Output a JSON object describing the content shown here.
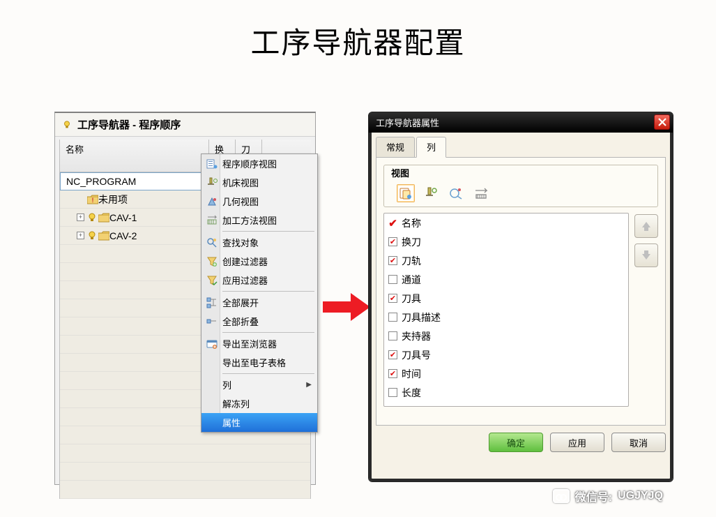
{
  "page_title": "工序导航器配置",
  "navigator": {
    "title": "工序导航器 - 程序顺序",
    "columns": [
      "名称",
      "换",
      "刀轨"
    ],
    "rows": [
      {
        "label": "NC_PROGRAM",
        "indent": 0,
        "selected": true,
        "expander": null
      },
      {
        "label": "未用项",
        "indent": 1,
        "selected": false,
        "expander": null,
        "icon": "folder-warn"
      },
      {
        "label": "CAV-1",
        "indent": 2,
        "selected": false,
        "expander": "+",
        "icon": "folder-bulb"
      },
      {
        "label": "CAV-2",
        "indent": 2,
        "selected": false,
        "expander": "+",
        "icon": "folder-bulb"
      }
    ]
  },
  "context_menu": {
    "groups": [
      [
        {
          "label": "程序顺序视图",
          "icon": "seq-view"
        },
        {
          "label": "机床视图",
          "icon": "machine-view"
        },
        {
          "label": "几何视图",
          "icon": "geom-view"
        },
        {
          "label": "加工方法视图",
          "icon": "method-view"
        }
      ],
      [
        {
          "label": "查找对象",
          "icon": "find"
        },
        {
          "label": "创建过滤器",
          "icon": "filter-new"
        },
        {
          "label": "应用过滤器",
          "icon": "filter-apply"
        }
      ],
      [
        {
          "label": "全部展开",
          "icon": "expand-all"
        },
        {
          "label": "全部折叠",
          "icon": "collapse-all"
        }
      ],
      [
        {
          "label": "导出至浏览器",
          "icon": "export-browser"
        },
        {
          "label": "导出至电子表格",
          "icon": "export-sheet"
        }
      ],
      [
        {
          "label": "列",
          "submenu": true
        },
        {
          "label": "解冻列"
        },
        {
          "label": "属性",
          "highlight": true
        }
      ]
    ]
  },
  "dialog": {
    "title": "工序导航器属性",
    "tabs": {
      "general": "常规",
      "columns": "列",
      "active": "columns"
    },
    "view_group": "视图",
    "column_options": [
      {
        "label": "名称",
        "state": "locked"
      },
      {
        "label": "换刀",
        "state": "checked"
      },
      {
        "label": "刀轨",
        "state": "checked"
      },
      {
        "label": "通道",
        "state": "unchecked"
      },
      {
        "label": "刀具",
        "state": "checked"
      },
      {
        "label": "刀具描述",
        "state": "unchecked"
      },
      {
        "label": "夹持器",
        "state": "unchecked"
      },
      {
        "label": "刀具号",
        "state": "checked"
      },
      {
        "label": "时间",
        "state": "checked"
      },
      {
        "label": "长度",
        "state": "unchecked"
      }
    ],
    "buttons": {
      "ok": "确定",
      "apply": "应用",
      "cancel": "取消"
    }
  },
  "watermark": {
    "label": "微信号:",
    "id": "UGJYJQ"
  }
}
